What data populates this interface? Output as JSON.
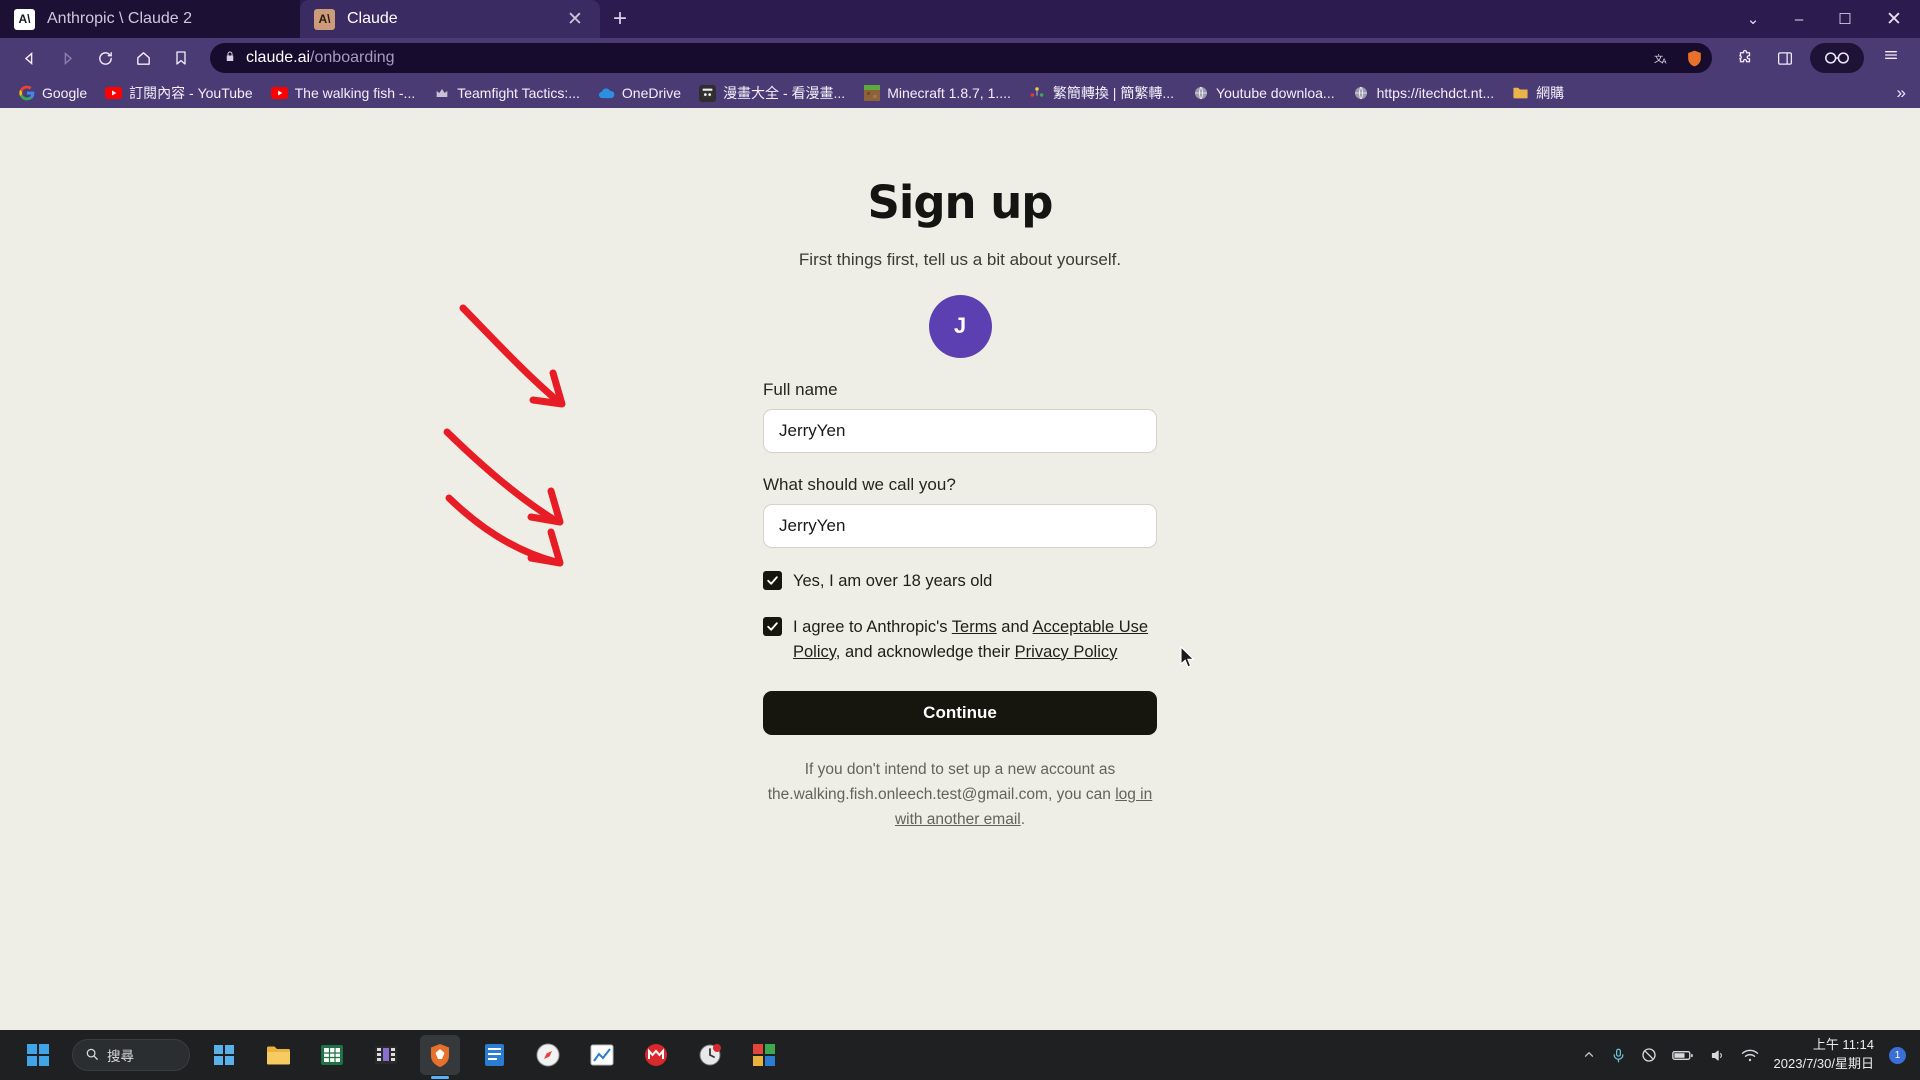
{
  "browser": {
    "tabs": [
      {
        "title": "Anthropic \\ Claude 2",
        "favicon_letters": "A\\",
        "active": false
      },
      {
        "title": "Claude",
        "favicon_letters": "A\\",
        "active": true
      }
    ],
    "newtab_label": "+",
    "window_controls": {
      "minimize": "–",
      "maximize": "☐",
      "close": "✕",
      "tab_search": "⌄"
    },
    "nav": {
      "back": "back-arrow",
      "forward": "forward-arrow",
      "reload": "reload",
      "home": "home",
      "bookmark": "bookmark-star"
    },
    "omnibox": {
      "lock_icon": "lock",
      "url_domain": "claude.ai",
      "url_path": "/onboarding",
      "translate_icon": "translate",
      "brave_shield_icon": "shield-lion"
    },
    "toolbar_icons": {
      "extensions": "puzzle-piece",
      "sidebar": "sidebar-panel",
      "profile": "profile-glasses",
      "menu": "hamburger-menu"
    },
    "bookmarks": [
      {
        "label": "Google",
        "icon": "google-g"
      },
      {
        "label": "訂閱內容 - YouTube",
        "icon": "youtube-play"
      },
      {
        "label": "The walking fish -...",
        "icon": "youtube-play"
      },
      {
        "label": "Teamfight Tactics:...",
        "icon": "tft-crown"
      },
      {
        "label": "OneDrive",
        "icon": "onedrive-cloud"
      },
      {
        "label": "漫畫大全 - 看漫畫...",
        "icon": "manga-robot"
      },
      {
        "label": "Minecraft 1.8.7, 1....",
        "icon": "minecraft-grass"
      },
      {
        "label": "繁簡轉換 | 簡繁轉...",
        "icon": "convert-dots"
      },
      {
        "label": "Youtube downloa...",
        "icon": "globe"
      },
      {
        "label": "https://itechdct.nt...",
        "icon": "globe"
      },
      {
        "label": "網購",
        "icon": "folder"
      }
    ],
    "bookmarks_overflow": "»"
  },
  "page": {
    "title": "Sign up",
    "subtitle": "First things first, tell us a bit about yourself.",
    "avatar": {
      "initial": "J",
      "color": "#5C3FB0"
    },
    "fields": [
      {
        "label": "Full name",
        "value": "JerryYen",
        "placeholder": "Full name"
      },
      {
        "label": "What should we call you?",
        "value": "JerryYen",
        "placeholder": "What should we call you?"
      }
    ],
    "checkboxes": [
      {
        "checked": true,
        "text": "Yes, I am over 18 years old"
      }
    ],
    "terms": {
      "checked": true,
      "prefix": "I agree to Anthropic's ",
      "link_terms": "Terms",
      "conjunction": " and ",
      "link_aup": "Acceptable Use Policy",
      "middle": ", and acknowledge their ",
      "link_privacy": "Privacy Policy"
    },
    "continue_label": "Continue",
    "footnote": {
      "line1": "If you don't intend to set up a new account as",
      "email": "the.walking.fish.onleech.test@gmail.com",
      "line2": ", you can ",
      "link": "log in with another email",
      "period": "."
    }
  },
  "taskbar": {
    "start_label": "start-windows-logo",
    "search_placeholder": "搜尋",
    "search_icon": "search-magnifier",
    "apps": [
      {
        "name": "microsoft-store",
        "active": false
      },
      {
        "name": "file-explorer",
        "active": false
      },
      {
        "name": "excel",
        "active": false
      },
      {
        "name": "video-editor",
        "active": false
      },
      {
        "name": "brave-browser",
        "active": true
      },
      {
        "name": "libreoffice-writer",
        "active": false
      },
      {
        "name": "compass-safari",
        "active": false
      },
      {
        "name": "chart-app",
        "active": false
      },
      {
        "name": "mega-cloud",
        "active": false
      },
      {
        "name": "clock-timer",
        "active": false
      },
      {
        "name": "photos-gallery",
        "active": false
      }
    ],
    "tray": {
      "chevron": "show-hidden-icons",
      "mic": "microphone",
      "mute": "mute-circle",
      "battery": "battery",
      "volume": "speaker-volume",
      "network": "network-wifi",
      "notification_count": "1"
    },
    "clock": {
      "time": "上午 11:14",
      "date": "2023/7/30/星期日"
    }
  }
}
